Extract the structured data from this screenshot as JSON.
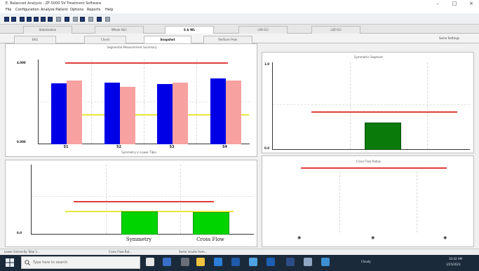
{
  "window": {
    "title": "E. Balanced Analysis - ZF-5000 SV Treatment Software",
    "menu": [
      "File",
      "Configuration",
      "Analyze Patient",
      "Options",
      "Reports",
      "Help"
    ]
  },
  "tabs": [
    "Stabilization",
    "Whole S&C",
    "S & WL",
    "LSR-SCI",
    "LSR-SCI"
  ],
  "active_tab_index": 2,
  "subtabs": [
    "EKG",
    "Chord",
    "Snapshot",
    "Rel/Sum Peak"
  ],
  "active_subtab_index": 2,
  "settings_label": "Some Settings",
  "top_left_panel": {
    "title": "Segmental Measurement Summary",
    "ymax_label": "4.000",
    "ymin_label": "0.000",
    "footer": "Symmetry in Lower Tibia",
    "colors": {
      "primary": "#0000e6",
      "secondary": "#f7a1a1"
    }
  },
  "top_right_panel": {
    "title": "Symmetric Segment",
    "ymax_label": "1.0",
    "ymin_label": "0.0",
    "colors": {
      "bar": "#0a7a0a"
    }
  },
  "bottom_left_panel": {
    "ymin_label": "0.0",
    "colors": {
      "bar": "#00d400"
    }
  },
  "bottom_right_panel": {
    "title": "Cross Flow Ratios",
    "bottom_markers": [
      "◉",
      "◉",
      "◉"
    ]
  },
  "chart_data": [
    {
      "type": "bar",
      "categories": [
        "S1",
        "S2",
        "S3",
        "S4"
      ],
      "series": [
        {
          "values": [
            2.88,
            2.91,
            2.83,
            3.1
          ]
        },
        {
          "values": [
            3.0,
            2.72,
            2.92,
            3.01
          ]
        }
      ],
      "reference_lines": [
        {
          "color": "#e03c3c",
          "value": 3.85
        },
        {
          "color": "#e8e63c",
          "value": 1.4
        }
      ],
      "ylim": [
        0,
        4
      ]
    },
    {
      "type": "bar",
      "categories": [
        ""
      ],
      "values": [
        0.31
      ],
      "reference_lines": [
        {
          "color": "#e03c3c",
          "value": 0.43
        }
      ],
      "ylim": [
        0,
        1.0
      ]
    },
    {
      "type": "bar",
      "categories": [
        "Symmetry",
        "Cross Flow"
      ],
      "values": [
        0.33,
        0.32
      ],
      "reference_lines": [
        {
          "color": "#e03c3c",
          "value": 0.47
        },
        {
          "color": "#e8e63c",
          "value": 0.33
        }
      ],
      "ylim": [
        0,
        1.0
      ]
    }
  ],
  "status": {
    "left": "Lower Extremity Total 1...",
    "mid": "Cross Flow Rat...",
    "right": "Some results from..."
  },
  "taskbar": {
    "search_placeholder": "Type here to search",
    "weather": "Cloudy",
    "time": "10:42 AM",
    "date": "1/25/2023"
  }
}
